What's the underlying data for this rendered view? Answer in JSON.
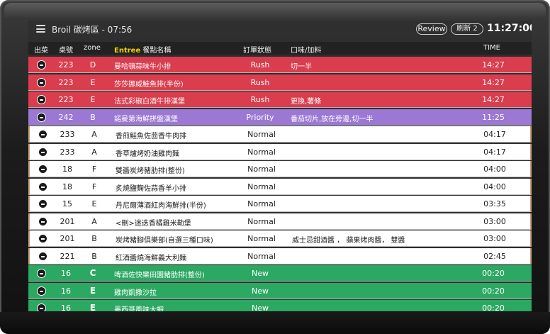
{
  "header": {
    "title": "Broil 碳烤區 - 07:56",
    "review_label": "Review",
    "refresh_label": "刷新 2",
    "clock": "11:27:00"
  },
  "columns": {
    "out": "出菜",
    "table": "桌號",
    "zone": "zone",
    "entree": "Entree",
    "name": "餐點名稱",
    "status": "訂單狀態",
    "flavor": "口味/加料",
    "time": "TIME"
  },
  "orders": [
    {
      "table": "223",
      "zone": "D",
      "name": "曼哈頓蒜味牛小排",
      "status": "Rush",
      "flavor": "切一半",
      "time": "14:27",
      "kind": "rush"
    },
    {
      "table": "223",
      "zone": "E",
      "name": "莎莎挪威鮭魚排(半份)",
      "status": "Rush",
      "flavor": "",
      "time": "14:27",
      "kind": "rush"
    },
    {
      "table": "223",
      "zone": "E",
      "name": "法式彩椒白酒牛排漢堡",
      "status": "Rush",
      "flavor": "更換,薯條",
      "time": "14:27",
      "kind": "rush"
    },
    {
      "table": "242",
      "zone": "B",
      "name": "諾曼第海鮮拼盤漢堡",
      "status": "Priority",
      "flavor": "番茄切片,放在旁邊,切一半",
      "time": "11:25",
      "kind": "priority"
    },
    {
      "table": "233",
      "zone": "A",
      "name": "香煎鮭魚佐茴香牛肉排",
      "status": "Normal",
      "flavor": "",
      "time": "04:17",
      "kind": "normal"
    },
    {
      "table": "233",
      "zone": "A",
      "name": "香草爐烤奶油雞肉麵",
      "status": "Normal",
      "flavor": "",
      "time": "04:17",
      "kind": "normal"
    },
    {
      "table": "18",
      "zone": "F",
      "name": "雙醬炭烤豬肋排(整份)",
      "status": "Normal",
      "flavor": "",
      "time": "04:00",
      "kind": "normal"
    },
    {
      "table": "18",
      "zone": "F",
      "name": "炙燒鹽麴佐蒜香羊小排",
      "status": "Normal",
      "flavor": "",
      "time": "04:00",
      "kind": "normal"
    },
    {
      "table": "15",
      "zone": "E",
      "name": "丹尼爾薄酒紅肉海鮮排(半份)",
      "status": "Normal",
      "flavor": "",
      "time": "03:35",
      "kind": "normal"
    },
    {
      "table": "201",
      "zone": "A",
      "name": "<刪>迷迭香橘雞米勒堡",
      "status": "Normal",
      "flavor": "",
      "time": "03:00",
      "kind": "normal"
    },
    {
      "table": "201",
      "zone": "B",
      "name": "炭烤豬腳俱樂部(自選三種口味)",
      "status": "Normal",
      "flavor": "威士忌甜酒醬 ， 蘋果烤肉醬， 雙醬",
      "time": "03:00",
      "kind": "normal"
    },
    {
      "table": "221",
      "zone": "B",
      "name": "紅酒醬燒海鮮義大利麵",
      "status": "Normal",
      "flavor": "",
      "time": "02:45",
      "kind": "normal"
    },
    {
      "table": "16",
      "zone": "C",
      "name": "啤酒佐快樂田園豬肋排(整份)",
      "status": "New",
      "flavor": "",
      "time": "00:20",
      "kind": "new"
    },
    {
      "table": "16",
      "zone": "E",
      "name": "雞肉凱撒沙拉",
      "status": "New",
      "flavor": "",
      "time": "00:20",
      "kind": "new"
    },
    {
      "table": "16",
      "zone": "E",
      "name": "墨西哥風味大蝦",
      "status": "New",
      "flavor": "",
      "time": "00:20",
      "kind": "new"
    }
  ],
  "colors": {
    "rush": "#d93d4e",
    "priority": "#9b78d4",
    "normal": "#ffffff",
    "new": "#2ba862"
  }
}
